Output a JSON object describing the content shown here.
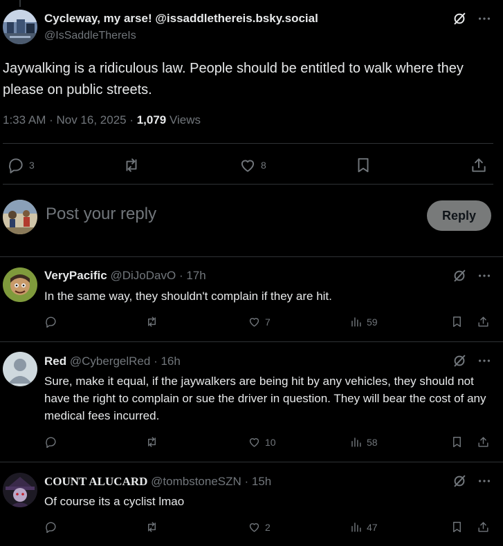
{
  "post": {
    "display_name": "Cycleway, my arse! @issaddlethereis.bsky.social",
    "handle": "@IsSaddleThereIs",
    "text": "Jaywalking is a ridiculous law. People should be entitled to walk where they please on public streets.",
    "timestamp": "1:33 AM · Nov 16, 2025 · ",
    "views_count": "1,079",
    "views_label": " Views",
    "reply_count": "3",
    "repost_count": "",
    "like_count": "8"
  },
  "composer": {
    "placeholder": "Post your reply",
    "button_label": "Reply"
  },
  "replies": [
    {
      "name": "VeryPacific",
      "handle": "@DiJoDavO",
      "time": " · 17h",
      "text": "In the same way, they shouldn't complain if they are hit.",
      "replies": "",
      "reposts": "",
      "likes": "7",
      "views": "59"
    },
    {
      "name": "Red",
      "handle": "@CybergelRed",
      "time": " · 16h",
      "text": "Sure, make it equal, if the jaywalkers are being hit by any vehicles, they should not have the right to complain or sue the driver in question. They will bear the cost of any medical fees incurred.",
      "replies": "",
      "reposts": "",
      "likes": "10",
      "views": "58"
    },
    {
      "name": "COUNT ALUCARD",
      "handle": "@tombstoneSZN",
      "time": " · 15h",
      "text": "Of course its a cyclist lmao",
      "replies": "",
      "reposts": "",
      "likes": "2",
      "views": "47"
    }
  ],
  "colors": {
    "background": "#000000",
    "text": "#e7e9ea",
    "secondary": "#71767b",
    "divider": "#2f3336",
    "reply_button": "#787a7a"
  },
  "icons": [
    "grok-icon",
    "more-icon",
    "reply-icon",
    "repost-icon",
    "like-icon",
    "bookmark-icon",
    "share-icon",
    "views-icon"
  ]
}
